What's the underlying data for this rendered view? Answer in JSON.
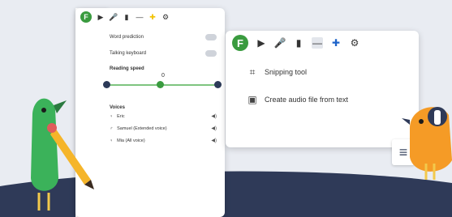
{
  "settings": {
    "word_prediction": "Word prediction",
    "talking_keyboard": "Talking keyboard",
    "reading_speed": "Reading speed",
    "reading_speed_value": "0",
    "voices_title": "Voices",
    "voices": [
      "Eric",
      "Samuel (Extended voice)",
      "Mia (All voice)"
    ]
  },
  "menu": {
    "snipping_tool": "Snipping tool",
    "create_audio": "Create audio file from text"
  },
  "colors": {
    "accent_green": "#3a9b3f",
    "slider_knob": "#2c3a58",
    "ground": "#2f3a58"
  }
}
